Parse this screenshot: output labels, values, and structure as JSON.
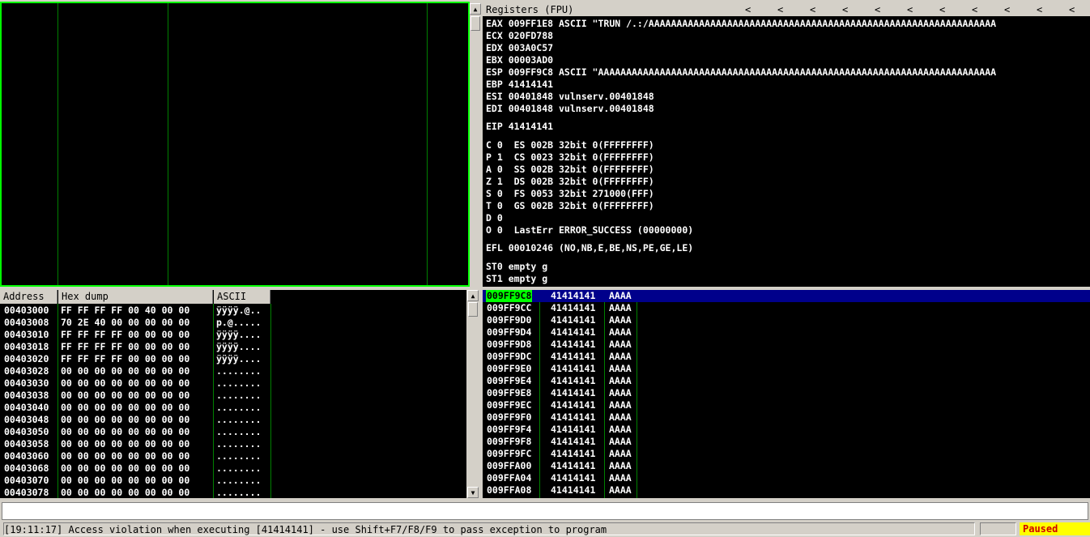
{
  "registers": {
    "title": "Registers (FPU)",
    "nav_arrows": [
      "<",
      "<",
      "<",
      "<",
      "<",
      "<",
      "<",
      "<",
      "<",
      "<",
      "<"
    ],
    "lines": [
      "EAX 009FF1E8 ASCII \"TRUN /.:/AAAAAAAAAAAAAAAAAAAAAAAAAAAAAAAAAAAAAAAAAAAAAAAAAAAAAAAAAAAAAA",
      "ECX 020FD788",
      "EDX 003A0C57",
      "EBX 00003AD0",
      "ESP 009FF9C8 ASCII \"AAAAAAAAAAAAAAAAAAAAAAAAAAAAAAAAAAAAAAAAAAAAAAAAAAAAAAAAAAAAAAAAAAAAAAA",
      "EBP 41414141",
      "ESI 00401848 vulnserv.00401848",
      "EDI 00401848 vulnserv.00401848",
      "EIP 41414141",
      "C 0  ES 002B 32bit 0(FFFFFFFF)",
      "P 1  CS 0023 32bit 0(FFFFFFFF)",
      "A 0  SS 002B 32bit 0(FFFFFFFF)",
      "Z 1  DS 002B 32bit 0(FFFFFFFF)",
      "S 0  FS 0053 32bit 271000(FFF)",
      "T 0  GS 002B 32bit 0(FFFFFFFF)",
      "D 0",
      "O 0  LastErr ERROR_SUCCESS (00000000)",
      "EFL 00010246 (NO,NB,E,BE,NS,PE,GE,LE)",
      "ST0 empty g",
      "ST1 empty g"
    ]
  },
  "dump": {
    "headers": {
      "address": "Address",
      "hex": "Hex dump",
      "ascii": "ASCII"
    },
    "rows": [
      {
        "addr": "00403000",
        "hex": "FF FF FF FF 00 40 00 00",
        "ascii": "ÿÿÿÿ.@.."
      },
      {
        "addr": "00403008",
        "hex": "70 2E 40 00 00 00 00 00",
        "ascii": "p.@....."
      },
      {
        "addr": "00403010",
        "hex": "FF FF FF FF 00 00 00 00",
        "ascii": "ÿÿÿÿ...."
      },
      {
        "addr": "00403018",
        "hex": "FF FF FF FF 00 00 00 00",
        "ascii": "ÿÿÿÿ...."
      },
      {
        "addr": "00403020",
        "hex": "FF FF FF FF 00 00 00 00",
        "ascii": "ÿÿÿÿ...."
      },
      {
        "addr": "00403028",
        "hex": "00 00 00 00 00 00 00 00",
        "ascii": "........"
      },
      {
        "addr": "00403030",
        "hex": "00 00 00 00 00 00 00 00",
        "ascii": "........"
      },
      {
        "addr": "00403038",
        "hex": "00 00 00 00 00 00 00 00",
        "ascii": "........"
      },
      {
        "addr": "00403040",
        "hex": "00 00 00 00 00 00 00 00",
        "ascii": "........"
      },
      {
        "addr": "00403048",
        "hex": "00 00 00 00 00 00 00 00",
        "ascii": "........"
      },
      {
        "addr": "00403050",
        "hex": "00 00 00 00 00 00 00 00",
        "ascii": "........"
      },
      {
        "addr": "00403058",
        "hex": "00 00 00 00 00 00 00 00",
        "ascii": "........"
      },
      {
        "addr": "00403060",
        "hex": "00 00 00 00 00 00 00 00",
        "ascii": "........"
      },
      {
        "addr": "00403068",
        "hex": "00 00 00 00 00 00 00 00",
        "ascii": "........"
      },
      {
        "addr": "00403070",
        "hex": "00 00 00 00 00 00 00 00",
        "ascii": "........"
      },
      {
        "addr": "00403078",
        "hex": "00 00 00 00 00 00 00 00",
        "ascii": "........"
      }
    ]
  },
  "stack": {
    "rows": [
      {
        "addr": "009FF9C8",
        "value": "41414141",
        "comment": "AAAA"
      },
      {
        "addr": "009FF9CC",
        "value": "41414141",
        "comment": "AAAA"
      },
      {
        "addr": "009FF9D0",
        "value": "41414141",
        "comment": "AAAA"
      },
      {
        "addr": "009FF9D4",
        "value": "41414141",
        "comment": "AAAA"
      },
      {
        "addr": "009FF9D8",
        "value": "41414141",
        "comment": "AAAA"
      },
      {
        "addr": "009FF9DC",
        "value": "41414141",
        "comment": "AAAA"
      },
      {
        "addr": "009FF9E0",
        "value": "41414141",
        "comment": "AAAA"
      },
      {
        "addr": "009FF9E4",
        "value": "41414141",
        "comment": "AAAA"
      },
      {
        "addr": "009FF9E8",
        "value": "41414141",
        "comment": "AAAA"
      },
      {
        "addr": "009FF9EC",
        "value": "41414141",
        "comment": "AAAA"
      },
      {
        "addr": "009FF9F0",
        "value": "41414141",
        "comment": "AAAA"
      },
      {
        "addr": "009FF9F4",
        "value": "41414141",
        "comment": "AAAA"
      },
      {
        "addr": "009FF9F8",
        "value": "41414141",
        "comment": "AAAA"
      },
      {
        "addr": "009FF9FC",
        "value": "41414141",
        "comment": "AAAA"
      },
      {
        "addr": "009FFA00",
        "value": "41414141",
        "comment": "AAAA"
      },
      {
        "addr": "009FFA04",
        "value": "41414141",
        "comment": "AAAA"
      },
      {
        "addr": "009FFA08",
        "value": "41414141",
        "comment": "AAAA"
      }
    ]
  },
  "command_line": {
    "value": ""
  },
  "status": {
    "message": "[19:11:17] Access violation when executing [41414141] - use Shift+F7/F8/F9 to pass exception to program",
    "state": "Paused"
  },
  "colors": {
    "pane_bg": "#000000",
    "focus_border": "#00ff00",
    "grid_line": "#008000",
    "selection_bg": "#00008b",
    "paused_bg": "#ffff00",
    "paused_fg": "#d00000"
  }
}
